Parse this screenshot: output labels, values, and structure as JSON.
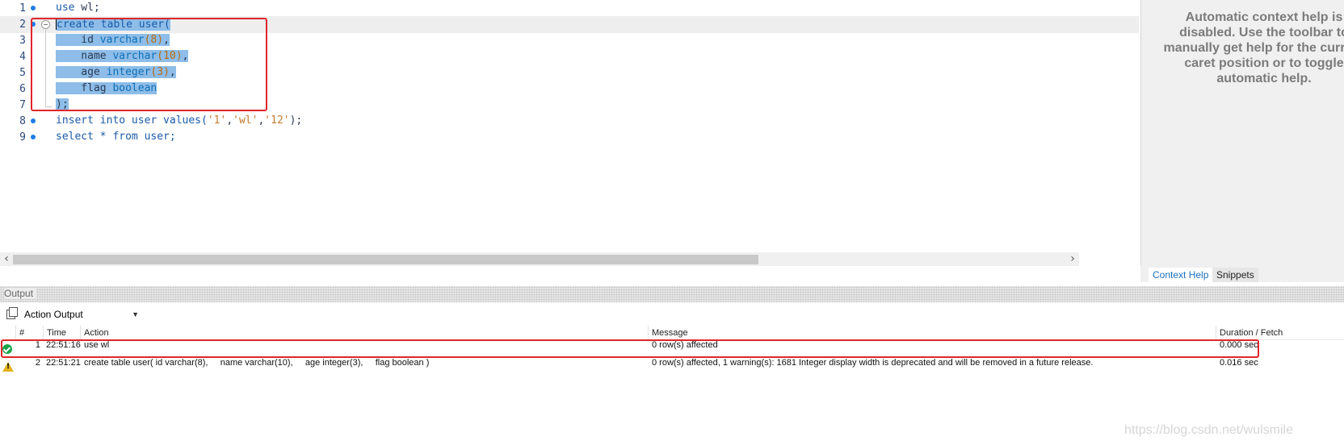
{
  "editor": {
    "lines": [
      {
        "n": "1"
      },
      {
        "n": "2"
      },
      {
        "n": "3"
      },
      {
        "n": "4"
      },
      {
        "n": "5"
      },
      {
        "n": "6"
      },
      {
        "n": "7"
      },
      {
        "n": "8"
      },
      {
        "n": "9"
      }
    ],
    "code": {
      "l1_use": "use",
      "l1_db": " wl;",
      "l2_create": "create table user(",
      "l3_col": "    id ",
      "l3_type": "varchar",
      "l3_arg": "(8)",
      "l3_end": ",",
      "l4_col": "    name ",
      "l4_type": "varchar",
      "l4_arg": "(10)",
      "l4_end": ",",
      "l5_col": "    age ",
      "l5_type": "integer",
      "l5_arg": "(3)",
      "l5_end": ",",
      "l6_col": "    flag ",
      "l6_type": "boolean",
      "l7_end": ");",
      "l8_kw": "insert into user values(",
      "l8_v1": "'1'",
      "l8_c1": ",",
      "l8_v2": "'wl'",
      "l8_c2": ",",
      "l8_v3": "'12'",
      "l8_end": ");",
      "l9_kw": "select * from user;"
    }
  },
  "help": {
    "message": "Automatic context help is disabled. Use the toolbar to manually get help for the current caret position or to toggle automatic help.",
    "tabs": [
      "Context Help",
      "Snippets"
    ]
  },
  "output": {
    "title": "Output",
    "selector": "Action Output",
    "columns": [
      "#",
      "Time",
      "Action",
      "Message",
      "Duration / Fetch"
    ],
    "rows": [
      {
        "status": "ok",
        "n": "1",
        "time": "22:51:16",
        "action": "use wl",
        "message": "0 row(s) affected",
        "duration": "0.000 sec"
      },
      {
        "status": "warning",
        "n": "2",
        "time": "22:51:21",
        "action": "create table user( id varchar(8),     name varchar(10),     age integer(3),     flag boolean )",
        "message": "0 row(s) affected, 1 warning(s): 1681 Integer display width is deprecated and will be removed in a future release.",
        "duration": "0.016 sec"
      }
    ]
  },
  "watermark": "https://blog.csdn.net/wulsmile",
  "colors": {
    "highlight_box": "#e0262a",
    "selection": "#8dbde8"
  }
}
